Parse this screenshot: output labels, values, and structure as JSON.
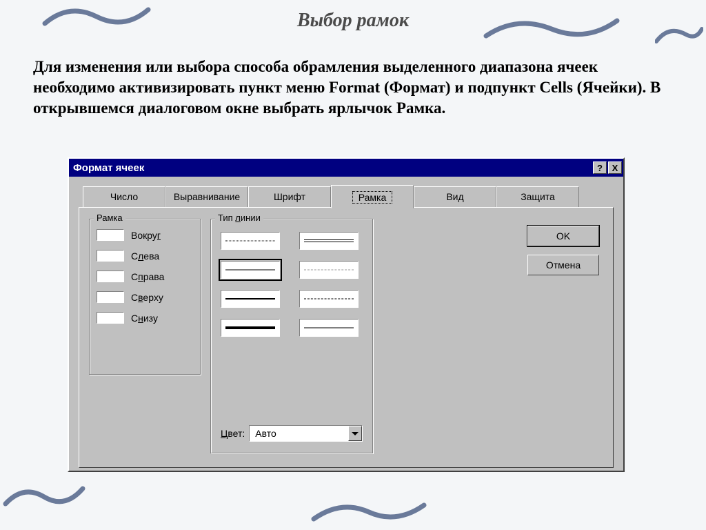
{
  "page": {
    "title": "Выбор рамок",
    "body_text": "Для изменения или выбора способа обрамления выделенного диапазона ячеек необходимо активизировать пункт меню Format (Формат) и подпункт Cells (Ячейки). В открывшемся диалоговом окне выбрать ярлычок Рамка."
  },
  "dialog": {
    "title": "Формат ячеек",
    "help_symbol": "?",
    "close_symbol": "X",
    "tabs": [
      "Число",
      "Выравнивание",
      "Шрифт",
      "Рамка",
      "Вид",
      "Защита"
    ],
    "active_tab": "Рамка",
    "buttons": {
      "ok": "OK",
      "cancel": "Отмена"
    },
    "group_border": {
      "legend": "Рамка",
      "items": [
        {
          "label": "Вокруг",
          "underline_char": "г"
        },
        {
          "label": "Слева",
          "underline_char": "л"
        },
        {
          "label": "Справа",
          "underline_char": "п"
        },
        {
          "label": "Сверху",
          "underline_char": "в"
        },
        {
          "label": "Снизу",
          "underline_char": "н"
        }
      ]
    },
    "group_line": {
      "legend": "Тип линии",
      "samples": [
        {
          "style": "dotted",
          "selected": false
        },
        {
          "style": "double",
          "selected": false
        },
        {
          "style": "thin",
          "selected": true
        },
        {
          "style": "fine-dash",
          "selected": false
        },
        {
          "style": "medium",
          "selected": false
        },
        {
          "style": "dash",
          "selected": false
        },
        {
          "style": "thick",
          "selected": false
        },
        {
          "style": "thin",
          "selected": false
        }
      ],
      "color_label": "Цвет:",
      "color_value": "Авто"
    }
  }
}
